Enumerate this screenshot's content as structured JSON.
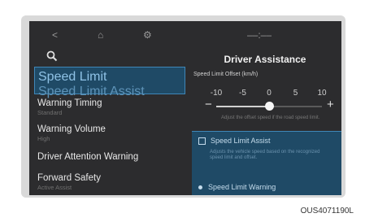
{
  "topbar": {
    "back": "<",
    "home": "⌂",
    "settings": "⚙",
    "status": "––:––"
  },
  "menu": {
    "items": [
      {
        "label": "Speed Limit",
        "sub": "Speed Limit Assist"
      },
      {
        "label": "Warning Timing",
        "sub": "Standard"
      },
      {
        "label": "Warning Volume",
        "sub": "High"
      },
      {
        "label": "Driver Attention Warning",
        "sub": ""
      },
      {
        "label": "Forward Safety",
        "sub": "Active Assist"
      }
    ]
  },
  "panel": {
    "title": "Driver Assistance",
    "offset_label": "Speed Limit Offset (km/h)",
    "ticks": [
      "-10",
      "-5",
      "0",
      "5",
      "10"
    ],
    "offset_value": 0,
    "offset_min": -10,
    "offset_max": 10,
    "minus": "−",
    "plus": "+",
    "note": "Adjust the offset speed if the road speed limit.",
    "options": [
      {
        "label": "Speed Limit Assist",
        "desc": "Adjusts the vehicle speed based on the recognized speed limit and offset."
      },
      {
        "label": "Speed Limit Warning"
      }
    ]
  },
  "figure_code": "OUS4071190L"
}
